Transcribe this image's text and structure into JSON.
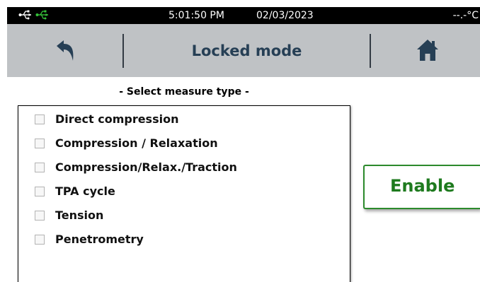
{
  "status_bar": {
    "time": "5:01:50 PM",
    "date": "02/03/2023",
    "temperature": "--.-°C",
    "icons": [
      "usb-icon",
      "usb-connected-icon"
    ],
    "usb_connected_color": "#35c23a"
  },
  "header": {
    "title": "Locked mode",
    "back_icon": "back-arrow-icon",
    "home_icon": "home-icon",
    "accent": "#263f55"
  },
  "section_title": "- Select measure type -",
  "measure_types": [
    {
      "label": "Direct compression",
      "checked": false
    },
    {
      "label": "Compression / Relaxation",
      "checked": false
    },
    {
      "label": "Compression/Relax./Traction",
      "checked": false
    },
    {
      "label": "TPA cycle",
      "checked": false
    },
    {
      "label": "Tension",
      "checked": false
    },
    {
      "label": "Penetrometry",
      "checked": false
    }
  ],
  "enable_button": {
    "label": "Enable",
    "color": "#1e7a1e"
  }
}
